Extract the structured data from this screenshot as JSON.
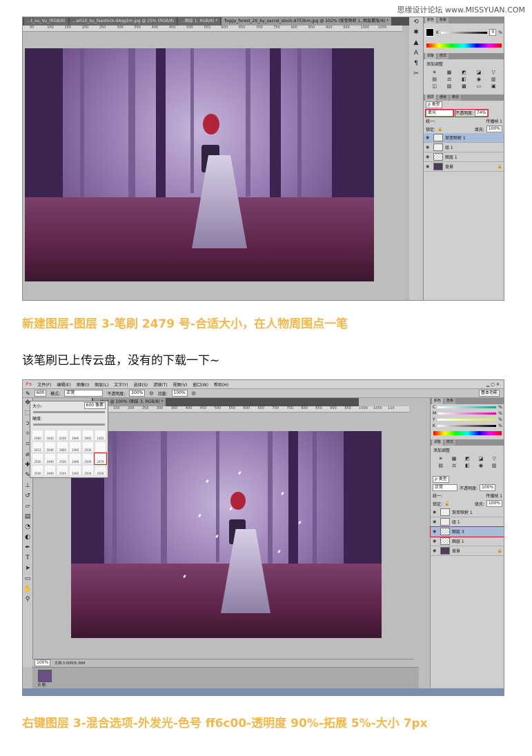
{
  "watermark": "思缘设计论坛 www.MISSYUAN.COM",
  "window1": {
    "tabs": [
      "...t_ou_Vu_(RGB/8)",
      "...wh10_by_faestock-d4qg2m.jpg @ 25% (RGB/8)",
      "...图层 1, RGB/8) *",
      "foggy_forest_26_by_sacral_stock-d753km.jpg @ 102% (渐变映射 1, 图层蒙版/8) *"
    ],
    "ruler_ticks": [
      "50",
      "100",
      "150",
      "200",
      "250",
      "300",
      "350",
      "400",
      "450",
      "500",
      "550",
      "600",
      "650",
      "700",
      "750",
      "800",
      "850",
      "900",
      "950",
      "1000",
      "1050"
    ],
    "color_panel": {
      "tabs": [
        "颜色",
        "色板"
      ],
      "k_value": "0",
      "unit": "%"
    },
    "adjust_panel": {
      "tabs": [
        "调整",
        "样式"
      ],
      "title": "添加调整"
    },
    "layers_panel": {
      "tabs": [
        "图层",
        "通道",
        "路径"
      ],
      "filter": "ρ 类型",
      "blend_mode": "柔光",
      "opacity_label": "不透明度:",
      "opacity": "74%",
      "unify_label": "统一:",
      "propagate_label": "传播帧 1",
      "lock_label": "锁定:",
      "fill_label": "填充:",
      "fill": "100%",
      "layers": [
        {
          "name": "渐变映射 1",
          "kind": "adjust",
          "active": true
        },
        {
          "name": "组 1",
          "kind": "group",
          "active": false
        },
        {
          "name": "图层 1",
          "kind": "check",
          "active": false
        },
        {
          "name": "背景",
          "kind": "dark",
          "active": false
        }
      ]
    }
  },
  "caption1": "新建图层-图层 3-笔刷 2479 号-合适大小，在人物周围点一笔",
  "note": "该笔刷已上传云盘，没有的下载一下~",
  "window2": {
    "logo": "Ps",
    "menu": [
      "文件(F)",
      "编辑(E)",
      "图像(I)",
      "图层(L)",
      "文字(Y)",
      "选择(S)",
      "滤镜(T)",
      "视图(V)",
      "窗口(W)",
      "帮助(H)"
    ],
    "options": {
      "brush_size": "600",
      "mode_label": "模式:",
      "mode": "正常",
      "opacity_label": "不透明度:",
      "opacity": "100%",
      "flow_label": "流量:",
      "flow": "100%",
      "workspace": "基本功能"
    },
    "doc_tab": "...sted @ 100% (图层 3, RGB/8) *",
    "ruler_ticks": [
      "100",
      "150",
      "200",
      "250",
      "300",
      "350",
      "400",
      "450",
      "500",
      "550",
      "600",
      "650",
      "700",
      "750",
      "800",
      "850",
      "900",
      "950",
      "1000",
      "1050",
      "110"
    ],
    "brush_picker": {
      "size_label": "大小:",
      "size_value": "600 像素",
      "hardness_label": "硬度:",
      "rows": [
        [
          "1960",
          "1845",
          "2030",
          "1946",
          "1962",
          "1412"
        ],
        [
          "2013",
          "2046",
          "1860",
          "2490",
          "2500",
          ""
        ],
        [
          "2500",
          "2499",
          "2500",
          "2498",
          "2500",
          "2479"
        ],
        [
          "2500",
          "2499",
          "2500",
          "2400",
          "2504",
          "2500"
        ]
      ],
      "highlight": "2479"
    },
    "status": {
      "zoom": "100%",
      "doc": "文档:3.00M/6.38M"
    },
    "frame_label": "0 秒",
    "color_panel": {
      "tabs": [
        "颜色",
        "色板"
      ],
      "channels": [
        "C",
        "M",
        "Y",
        "K"
      ],
      "unit": "%"
    },
    "adjust_panel": {
      "tabs": [
        "调整",
        "样式"
      ],
      "title": "添加调整"
    },
    "layers_panel": {
      "filter": "ρ 类型",
      "blend_mode": "正常",
      "opacity_label": "不透明度:",
      "opacity": "100%",
      "unify_label": "统一:",
      "propagate_label": "传播帧 1",
      "lock_label": "锁定:",
      "fill_label": "填充:",
      "fill": "100%",
      "layers": [
        {
          "name": "渐变映射 1",
          "kind": "adjust",
          "active": false
        },
        {
          "name": "组 1",
          "kind": "group",
          "active": false
        },
        {
          "name": "图层 3",
          "kind": "check",
          "active": true
        },
        {
          "name": "图层 1",
          "kind": "check",
          "active": false
        },
        {
          "name": "背景",
          "kind": "dark",
          "active": false
        }
      ]
    }
  },
  "caption2": "右键图层 3-混合选项-外发光-色号 ff6c00-透明度 90%-拓展 5%-大小 7px"
}
